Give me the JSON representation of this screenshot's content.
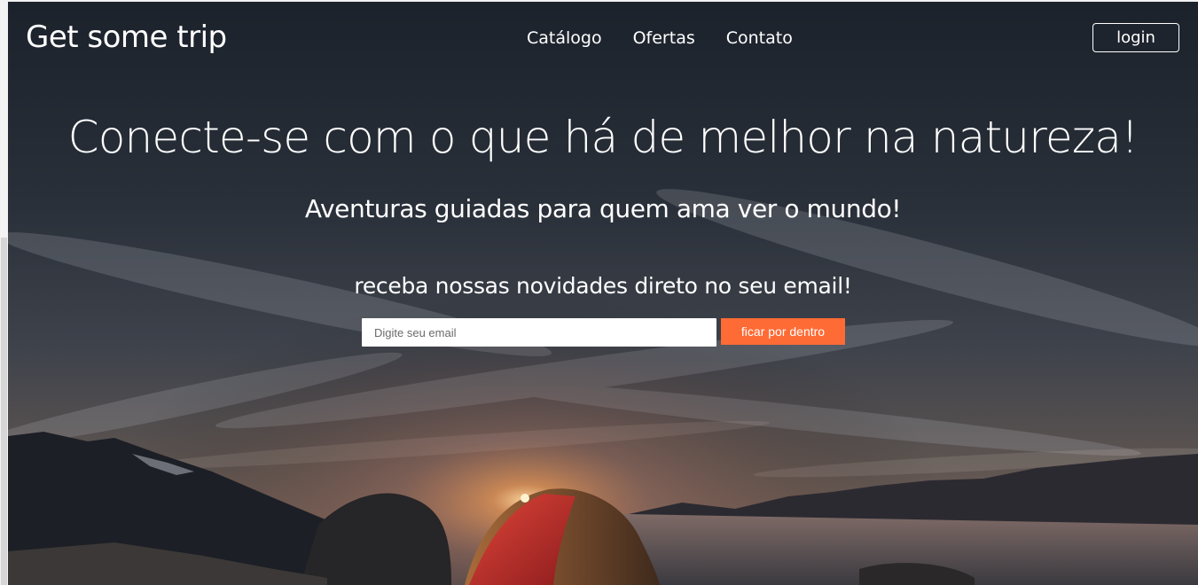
{
  "navbar": {
    "brand": "Get some trip",
    "links": [
      "Catálogo",
      "Ofertas",
      "Contato"
    ],
    "login_label": "login"
  },
  "hero": {
    "headline": "Conecte-se com o que há de melhor na natureza!",
    "subtitle": "Aventuras guiadas para quem ama ver o mundo!",
    "newsletter_text": "receba nossas novidades direto no seu email!",
    "email_placeholder": "Digite seu email",
    "email_value": "",
    "submit_label": "ficar por dentro"
  },
  "colors": {
    "accent": "#ff6b35",
    "text": "#ffffff",
    "sky_dark": "#1f2630",
    "sunset": "#f29a55"
  }
}
